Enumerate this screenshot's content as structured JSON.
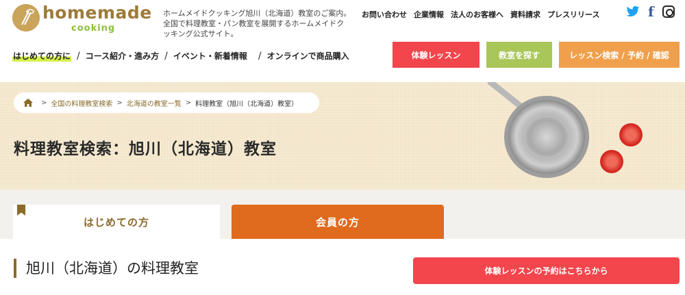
{
  "header": {
    "logo": {
      "main": "homemade",
      "sub": "cooking"
    },
    "tagline": "ホームメイドクッキング旭川（北海道）教室のご案内。全国で料理教室・パン教室を展開するホームメイドクッキング公式サイト。",
    "top_links": [
      "お問い合わせ",
      "企業情報",
      "法人のお客様へ",
      "資料請求",
      "プレスリリース"
    ],
    "social": {
      "twitter": "twitter-icon",
      "facebook": "f",
      "instagram": "instagram-icon"
    },
    "nav": {
      "first": "はじめての方に",
      "items": [
        "コース紹介・進み方",
        "イベント・新着情報",
        "オンラインで商品購入"
      ]
    },
    "buttons": {
      "trial": "体験レッスン",
      "find": "教室を探す",
      "search": "レッスン検索 / 予約 / 確認"
    }
  },
  "hero": {
    "breadcrumb": [
      "全国の料理教室検索",
      "北海道の教室一覧",
      "料理教室（旭川（北海道）教室）"
    ],
    "title": "料理教室検索：旭川（北海道）教室"
  },
  "tabs": {
    "first": "はじめての方",
    "member": "会員の方"
  },
  "section": {
    "title": "旭川（北海道）の料理教室",
    "cta": "体験レッスンの予約はこちらから"
  },
  "colors": {
    "accent_red": "#f2454c",
    "accent_green": "#a9c659",
    "accent_orange": "#f0a04c",
    "tab_orange": "#e06a1e",
    "brand_brown": "#8a6a2a"
  }
}
